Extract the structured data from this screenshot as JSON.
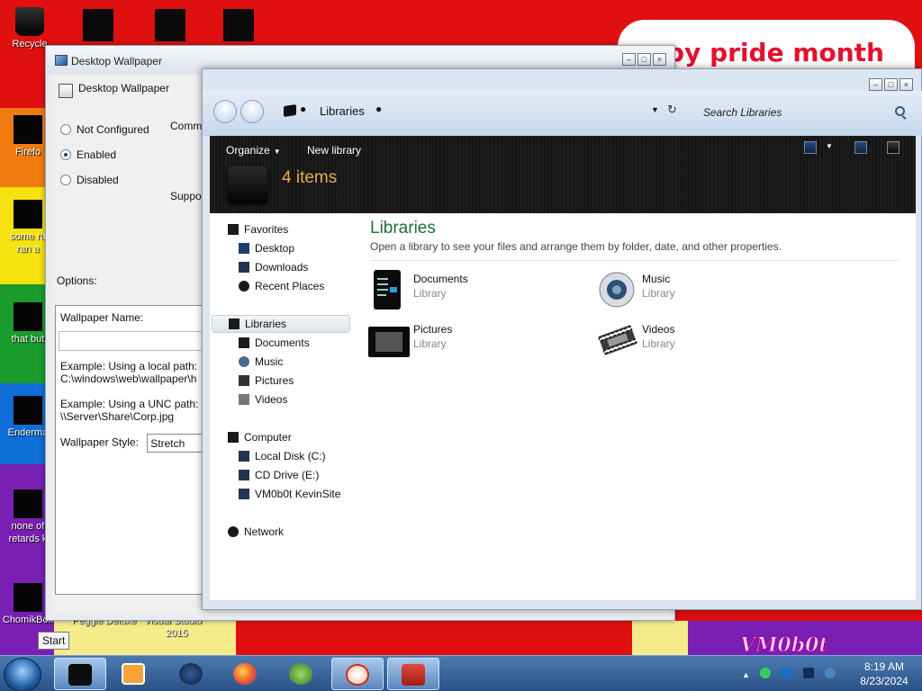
{
  "desktop": {
    "banner_text": "ppy pride month",
    "corner_logo": "VM0b0t",
    "icons": [
      {
        "label": "Recycle",
        "glyph_color": "#111111"
      },
      {
        "label": "Firefo",
        "glyph_color": "#080808"
      },
      {
        "label": "some ru",
        "label2": "ran a",
        "glyph_color": "#080808"
      },
      {
        "label": "that but",
        "glyph_color": "#080808"
      },
      {
        "label": "Enderma",
        "glyph_color": "#080808"
      },
      {
        "label": "none of",
        "label2": "retards k",
        "glyph_color": "#080808"
      },
      {
        "label": "ChomikBox",
        "glyph_color": "#080808"
      }
    ],
    "bottom_labels": [
      "Peggle Deluxe",
      "Visual Studio",
      "2015"
    ]
  },
  "policy_window": {
    "title": "Desktop Wallpaper",
    "header": "Desktop Wallpaper",
    "options": [
      "Not Configured",
      "Enabled",
      "Disabled"
    ],
    "selected_option": "Enabled",
    "comment_label": "Comm",
    "supported_label": "Suppo",
    "options_label": "Options:",
    "wallpaper_name_label": "Wallpaper Name:",
    "example_local_label": "Example: Using a local path:",
    "example_local_path": "C:\\windows\\web\\wallpaper\\h",
    "example_unc_label": "Example: Using a UNC path:",
    "example_unc_path": "\\\\Server\\Share\\Corp.jpg",
    "style_label": "Wallpaper Style:",
    "style_value": "Stretch"
  },
  "explorer": {
    "address": "Libraries",
    "search_placeholder": "Search Libraries",
    "toolbar": {
      "organize": "Organize",
      "new_library": "New library",
      "item_count": "4 items"
    },
    "nav": {
      "favorites": "Favorites",
      "favorite_items": [
        "Desktop",
        "Downloads",
        "Recent Places"
      ],
      "libraries": "Libraries",
      "library_items": [
        "Documents",
        "Music",
        "Pictures",
        "Videos"
      ],
      "computer": "Computer",
      "computer_items": [
        "Local Disk (C:)",
        "CD Drive (E:)",
        "VM0b0t KevinSite"
      ],
      "network": "Network"
    },
    "content": {
      "title": "Libraries",
      "subtitle": "Open a library to see your files and arrange them by folder, date, and other properties.",
      "items": [
        {
          "name": "Documents",
          "type": "Library",
          "icon": "documents-library-icon"
        },
        {
          "name": "Music",
          "type": "Library",
          "icon": "music-library-icon"
        },
        {
          "name": "Pictures",
          "type": "Library",
          "icon": "pictures-library-icon"
        },
        {
          "name": "Videos",
          "type": "Library",
          "icon": "videos-library-icon"
        }
      ]
    }
  },
  "taskbar": {
    "start_tooltip": "Start",
    "pinned": [
      "explorer-icon",
      "media-player-icon",
      "globe-icon",
      "firefox-icon",
      "media-center-icon",
      "no-signal-app-icon",
      "toolbox-icon"
    ],
    "time": "8:19 AM",
    "date": "8/23/2024"
  },
  "colors": {
    "content_title": "#1e6d3e",
    "item_count": "#e5ad4f",
    "taskbar": "#2a5287"
  }
}
